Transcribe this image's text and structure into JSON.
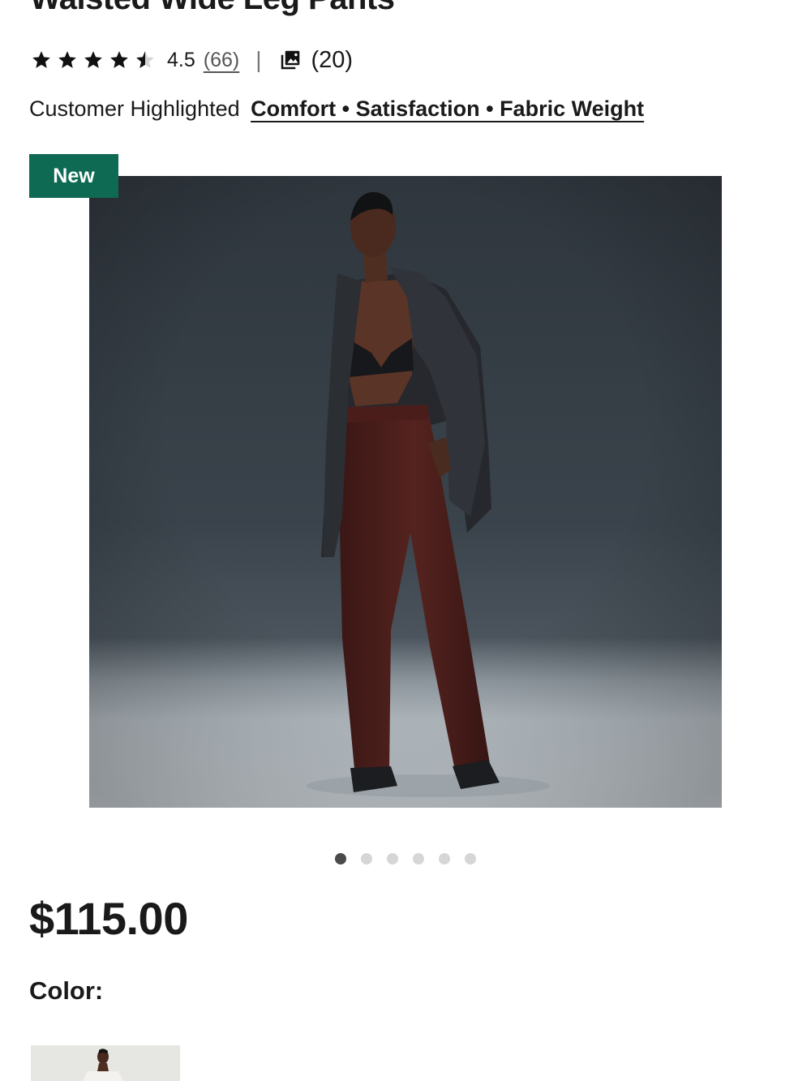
{
  "product": {
    "title": "Waisted Wide Leg Pants",
    "rating": {
      "value": "4.5",
      "review_count": "(66)",
      "separator": "|",
      "photo_count": "(20)",
      "stars": 4.5
    },
    "highlights": {
      "prefix": "Customer Highlighted",
      "link_text": "Comfort • Satisfaction • Fabric Weight"
    },
    "badge": "New",
    "carousel": {
      "total": 6,
      "active_index": 1
    },
    "price": "$115.00",
    "color_label": "Color:"
  },
  "colors": {
    "badge_bg": "#0f6a54",
    "dot_active": "#4a4a4a",
    "dot_inactive": "#d6d6d6"
  },
  "icons": {
    "star": "star-icon",
    "half_star": "half-star-icon",
    "photos": "image-gallery-icon"
  }
}
